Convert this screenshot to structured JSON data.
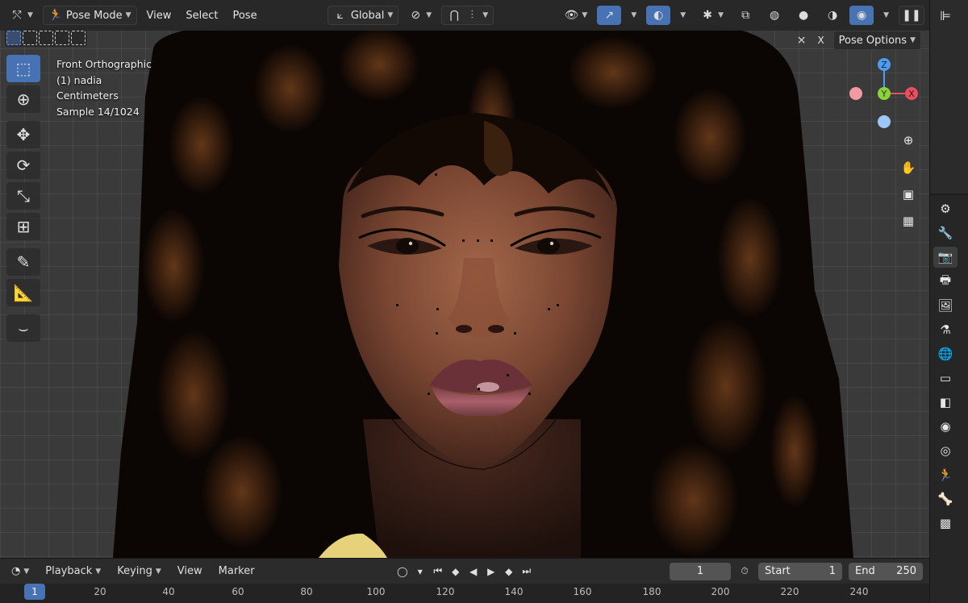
{
  "header": {
    "editor_icon": "editor-type-icon",
    "mode_label": "Pose Mode",
    "menus": [
      "View",
      "Select",
      "Pose"
    ],
    "orientation_label": "Global",
    "pose_options_label": "Pose Options",
    "x_label": "X"
  },
  "overlay": {
    "view_name": "Front Orthographic",
    "object_name": "(1) nadia",
    "units": "Centimeters",
    "sample": "Sample 14/1024"
  },
  "gizmo": {
    "z": "Z",
    "y": "Y",
    "x": "X"
  },
  "timeline": {
    "menus": [
      "Playback",
      "Keying",
      "View",
      "Marker"
    ],
    "current_frame": "1",
    "start_label": "Start",
    "start_value": "1",
    "end_label": "End",
    "end_value": "250",
    "ruler_current": "1",
    "ruler_ticks": [
      "20",
      "40",
      "60",
      "80",
      "100",
      "120",
      "140",
      "160",
      "180",
      "200",
      "220",
      "240"
    ]
  },
  "colors": {
    "accent": "#4772b3",
    "axis_x": "#e94f5f",
    "axis_y": "#8ad33a",
    "axis_z": "#4f9cf0"
  }
}
